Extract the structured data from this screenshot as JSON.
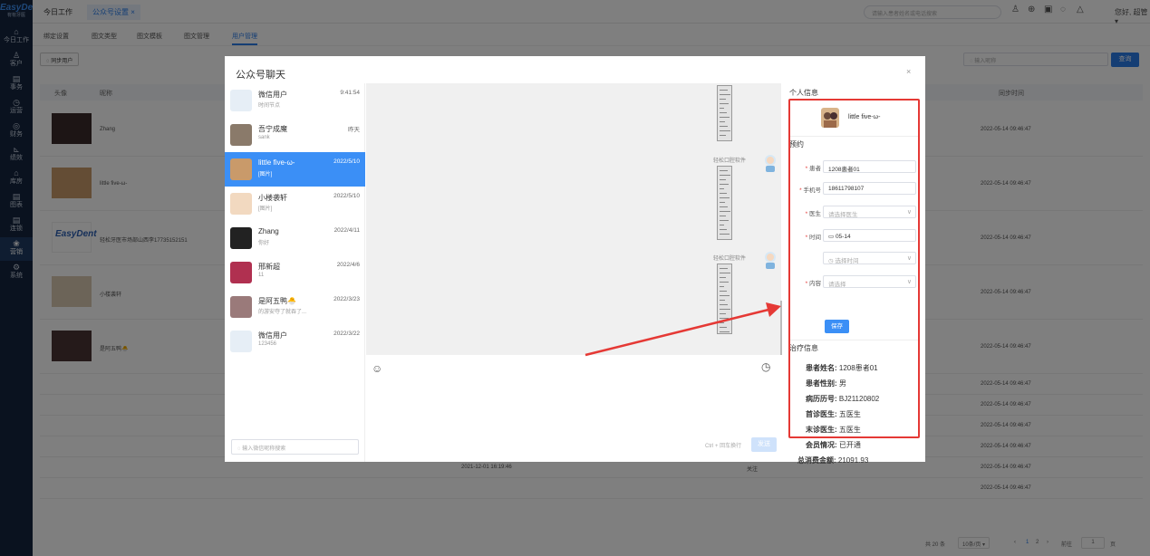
{
  "sidebar": {
    "logo": "EasyDent",
    "logo_sub": "有有牙医",
    "items": [
      {
        "label": "今日工作",
        "icon": "home-icon",
        "glyph": "⌂"
      },
      {
        "label": "客户",
        "icon": "user-icon",
        "glyph": "♙"
      },
      {
        "label": "事务",
        "icon": "document-icon",
        "glyph": "▤"
      },
      {
        "label": "运营",
        "icon": "clock-icon",
        "glyph": "◷"
      },
      {
        "label": "财务",
        "icon": "finance-icon",
        "glyph": "◎"
      },
      {
        "label": "绩效",
        "icon": "chart-icon",
        "glyph": "⊾"
      },
      {
        "label": "库房",
        "icon": "warehouse-icon",
        "glyph": "⌂"
      },
      {
        "label": "图表",
        "icon": "report-icon",
        "glyph": "▤"
      },
      {
        "label": "连锁",
        "icon": "chain-icon",
        "glyph": "▤"
      },
      {
        "label": "营销",
        "icon": "marketing-icon",
        "glyph": "❀"
      },
      {
        "label": "系统",
        "icon": "settings-icon",
        "glyph": "⚙"
      }
    ]
  },
  "topbar": {
    "tab_today": "今日工作",
    "tab_active": "公众号设置 ×",
    "search_placeholder": "请输入患者姓名或电话搜索",
    "greeting": "您好, 超管 ▾"
  },
  "subtabs": [
    "绑定设置",
    "图文类型",
    "图文模板",
    "图文管理",
    "用户管理"
  ],
  "main": {
    "sync_button": "◌ 同步用户",
    "nick_search_placeholder": "◌ 输入昵称",
    "query_button": "查询",
    "columns": [
      "头像",
      "昵称",
      "同步时间"
    ],
    "rows": [
      {
        "nick": "Zhang",
        "time": "2022-05-14 09:46:47"
      },
      {
        "nick": "little five-ω-",
        "time": "2022-05-14 09:46:47"
      },
      {
        "nick": "轻松牙医市场部山西李17735152151",
        "time": "2022-05-14 09:46:47"
      },
      {
        "nick": "小楼袭轩",
        "time": "2022-05-14 09:46:47"
      },
      {
        "nick": "是阿五鸭🐣",
        "time": "2022-05-14 09:46:47"
      }
    ],
    "empty_rows": [
      {
        "time": "2022-05-14 09:46:47"
      },
      {
        "time": "2022-05-14 09:46:47"
      },
      {
        "time": "2022-05-14 09:46:47"
      },
      {
        "time": "2022-05-14 09:46:47"
      },
      {
        "c3": "2021-12-01 16:19:46",
        "c4": "关注",
        "time": "2022-05-14 09:46:47"
      },
      {
        "time": "2022-05-14 09:46:47"
      }
    ],
    "pager": {
      "total": "共 20 条",
      "size": "10条/页 ▾",
      "prev": "‹",
      "p1": "1",
      "p2": "2",
      "next": "›",
      "goto": "前往",
      "page": "1",
      "page_unit": "页"
    }
  },
  "modal": {
    "title": "公众号聊天",
    "close": "×",
    "chats": [
      {
        "name": "微信用户",
        "preview": "时间节点",
        "date": "9:41:54"
      },
      {
        "name": "吾宁成魔",
        "preview": "sank",
        "date": "昨天"
      },
      {
        "name": "little five-ω-",
        "preview": "[图片]",
        "date": "2022/5/10"
      },
      {
        "name": "小楼袭轩",
        "preview": "[图片]",
        "date": "2022/5/10"
      },
      {
        "name": "Zhang",
        "preview": "你好",
        "date": "2022/4/11"
      },
      {
        "name": "邢新超",
        "preview": "11",
        "date": "2022/4/6"
      },
      {
        "name": "是阿五鸭🐣",
        "preview": "的游安夺了就吞了...",
        "date": "2022/3/23"
      },
      {
        "name": "微信用户",
        "preview": "123456",
        "date": "2022/3/22"
      }
    ],
    "chat_search_placeholder": "◌ 输入微信昵称搜索",
    "sender_name": "轻松口腔软件",
    "send_hint": "Ctrl + 回车换行",
    "send_button": "发送",
    "right": {
      "personal_heading": "个人信息",
      "profile_name": "little five-ω-",
      "appointment_heading": "预约",
      "fields": [
        {
          "label": "患者",
          "value": "1208患者01",
          "placeholder": false
        },
        {
          "label": "手机号",
          "value": "18611798107",
          "placeholder": false
        },
        {
          "label": "医生",
          "value": "请选择医生",
          "placeholder": true
        },
        {
          "label": "时间",
          "value": "▭ 05-14",
          "placeholder": false
        },
        {
          "label": "",
          "value": "◷ 选择时间",
          "placeholder": true
        },
        {
          "label": "内容",
          "value": "请选择",
          "placeholder": true
        }
      ],
      "save_button": "保存",
      "treatment_heading": "治疗信息",
      "treatment": [
        {
          "label": "患者姓名:",
          "value": "1208患者01"
        },
        {
          "label": "患者性别:",
          "value": "男"
        },
        {
          "label": "病历历号:",
          "value": "BJ21120802"
        },
        {
          "label": "首诊医生:",
          "value": "五医生"
        },
        {
          "label": "末诊医生:",
          "value": "五医生"
        },
        {
          "label": "会员情况:",
          "value": "已开通"
        },
        {
          "label": "总消费金额:",
          "value": "21091.93"
        }
      ]
    }
  },
  "colors": {
    "accent": "#3b8ff6",
    "sidebar": "#14253f",
    "highlight": "#e53935"
  }
}
